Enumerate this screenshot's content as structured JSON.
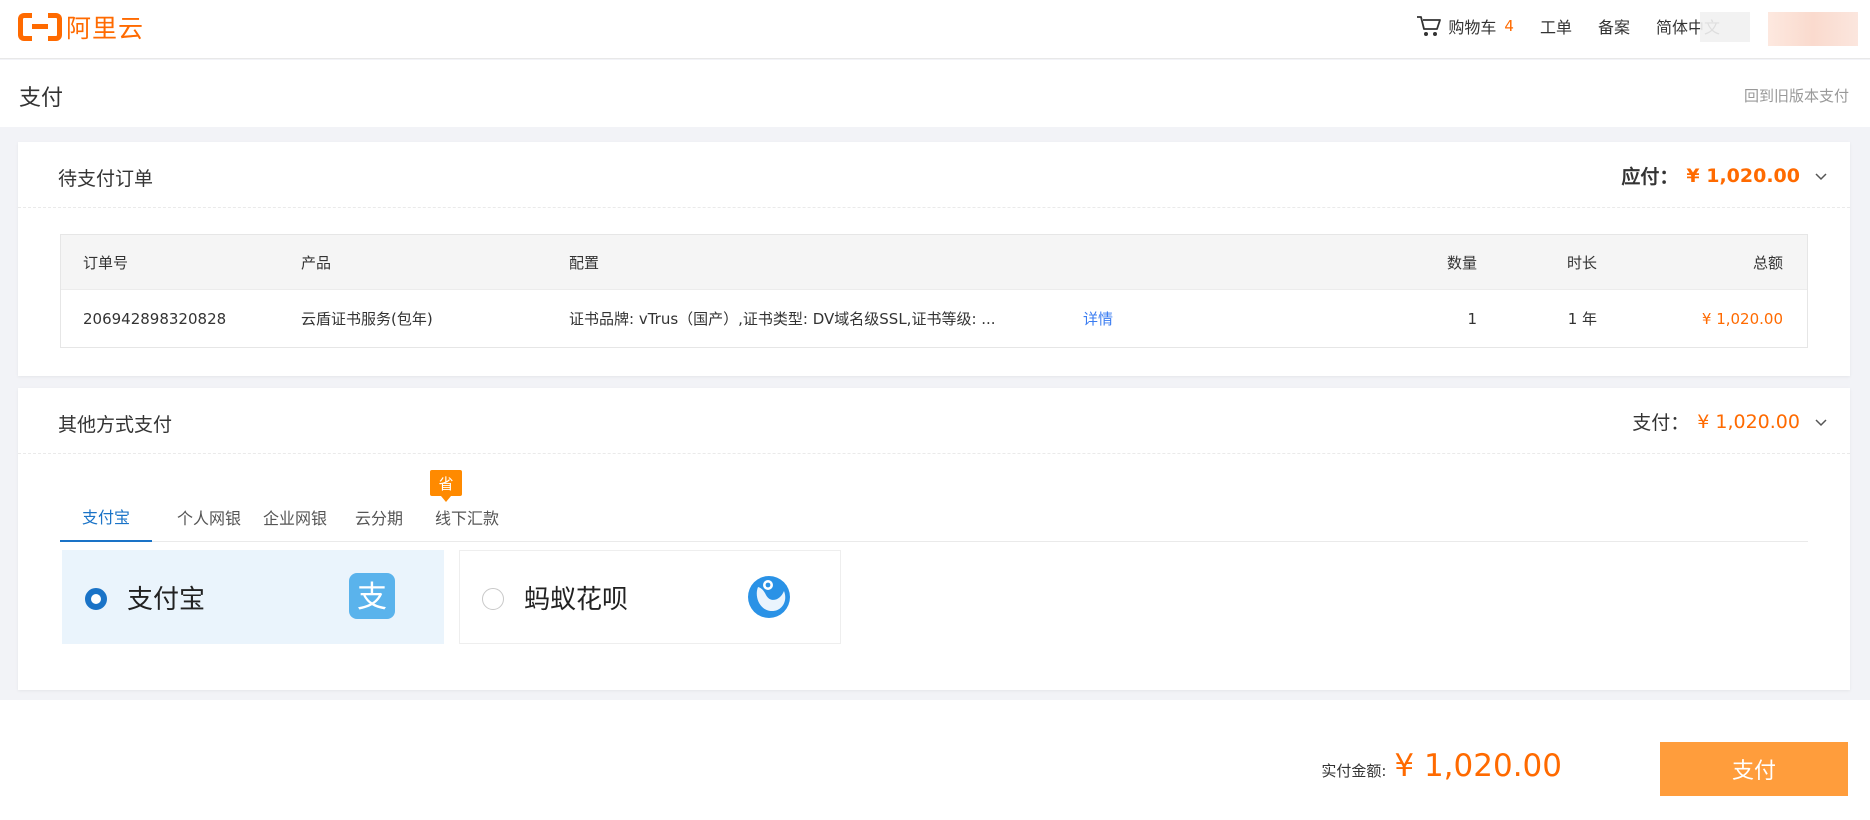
{
  "brand": {
    "logo_text": "阿里云",
    "accent": "#ff6a00"
  },
  "topnav": {
    "cart_label": "购物车",
    "cart_count": "4",
    "ticket_label": "工单",
    "filing_label": "备案",
    "language_label": "简体中文"
  },
  "page": {
    "title": "支付",
    "old_version_link": "回到旧版本支付"
  },
  "pending_orders": {
    "title": "待支付订单",
    "due_label": "应付：",
    "due_amount": "¥ 1,020.00",
    "columns": {
      "order_no": "订单号",
      "product": "产品",
      "config": "配置",
      "quantity": "数量",
      "duration": "时长",
      "total": "总额"
    },
    "rows": [
      {
        "order_no": "206942898320828",
        "product": "云盾证书服务(包年)",
        "config": "证书品牌: vTrus（国产）,证书类型: DV域名级SSL,证书等级: ...",
        "detail_link": "详情",
        "quantity": "1",
        "duration": "1 年",
        "total": "¥ 1,020.00"
      }
    ]
  },
  "other_payment": {
    "title": "其他方式支付",
    "pay_label": "支付：",
    "pay_amount": "¥ 1,020.00",
    "tabs": [
      {
        "label": "支付宝",
        "active": true
      },
      {
        "label": "个人网银",
        "active": false
      },
      {
        "label": "企业网银",
        "active": false
      },
      {
        "label": "云分期",
        "active": false
      },
      {
        "label": "线下汇款",
        "active": false
      }
    ],
    "save_badge": "省",
    "options": [
      {
        "label": "支付宝",
        "selected": true,
        "icon": "alipay-icon"
      },
      {
        "label": "蚂蚁花呗",
        "selected": false,
        "icon": "huabei-icon"
      }
    ]
  },
  "footer": {
    "actual_label": "实付金额:",
    "actual_amount": "¥ 1,020.00",
    "pay_button": "支付"
  }
}
